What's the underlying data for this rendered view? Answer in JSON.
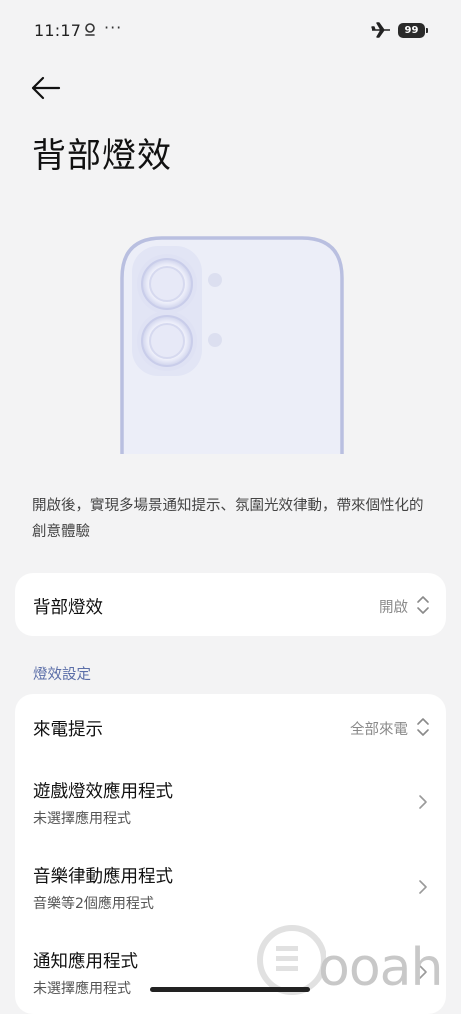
{
  "status_bar": {
    "time": "11:17",
    "dots": "···",
    "battery": "99"
  },
  "page": {
    "title": "背部燈效",
    "description": "開啟後，實現多場景通知提示、氛圍光效律動，帶來個性化的創意體驗"
  },
  "main_toggle": {
    "label": "背部燈效",
    "value": "開啟"
  },
  "section_header": "燈效設定",
  "settings": [
    {
      "label": "來電提示",
      "value": "全部來電"
    },
    {
      "label": "遊戲燈效應用程式",
      "sub": "未選擇應用程式"
    },
    {
      "label": "音樂律動應用程式",
      "sub": "音樂等2個應用程式"
    },
    {
      "label": "通知應用程式",
      "sub": "未選擇應用程式"
    }
  ],
  "watermark": {
    "text": "ooah"
  },
  "colors": {
    "background": "#f3f3f4",
    "card": "#ffffff",
    "section_header": "#5b6ea8",
    "phone_outline": "#b9bfe0"
  },
  "icons": [
    "location-pin-icon",
    "airplane-icon",
    "back-arrow-icon",
    "up-down-icon",
    "chevron-right-icon"
  ]
}
